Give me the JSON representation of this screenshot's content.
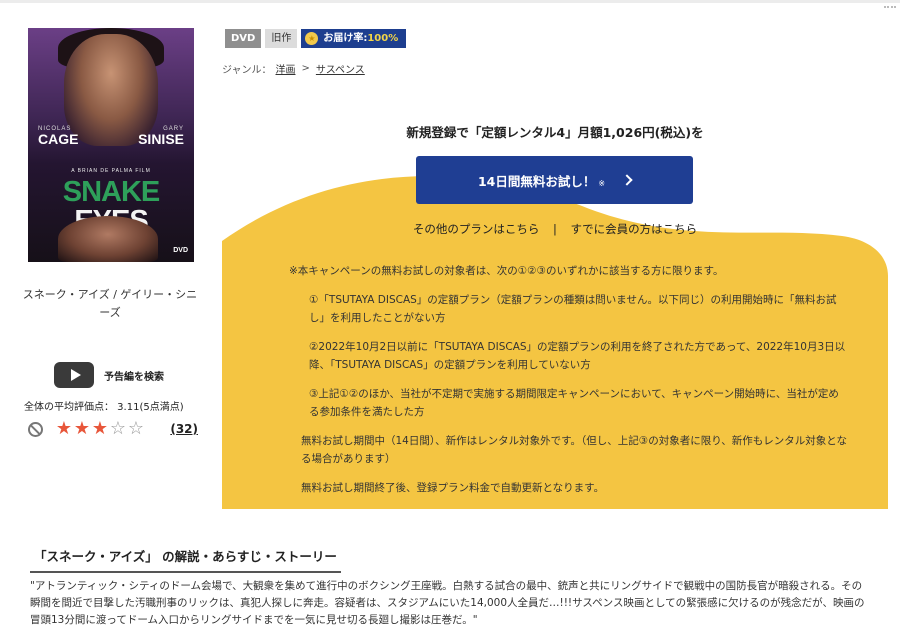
{
  "badges": {
    "format": "DVD",
    "catalog": "旧作",
    "delivery_label": "お届け率:",
    "delivery_rate": "100%"
  },
  "genre": {
    "label": "ジャンル：",
    "crumbs": [
      "洋画",
      "サスペンス"
    ],
    "separator": ">"
  },
  "poster": {
    "actor1_first": "NICOLAS",
    "actor1_last": "CAGE",
    "actor2_first": "GARY",
    "actor2_last": "SINISE",
    "director": "A BRIAN DE PALMA FILM",
    "title_part1": "SNAKE",
    "title_part2": "EYES",
    "format_mark": "DVD"
  },
  "item": {
    "name": "スネーク・アイズ / ゲイリー・シニーズ"
  },
  "trailer": {
    "label": "予告編を検索"
  },
  "rating": {
    "text": "全体の平均評価点： 3.11(5点満点)",
    "value": 3.11,
    "max": 5,
    "stars": [
      "★",
      "★",
      "★",
      "☆",
      "☆"
    ],
    "review_count": "(32)"
  },
  "campaign": {
    "headline": "新規登録で「定額レンタル4」月額1,026円(税込)を",
    "button_label": "14日間無料お試し！",
    "button_note": "※",
    "other_plans": "その他のプランはこちら",
    "divider": "|",
    "members": "すでに会員の方はこちら",
    "accent_color": "#f4c542",
    "button_color": "#1f3e93"
  },
  "terms": {
    "lead": "※本キャンペーンの無料お試しの対象者は、次の①②③のいずれかに該当する方に限ります。",
    "item1": "①「TSUTAYA DISCAS」の定額プラン（定額プランの種類は問いません。以下同じ）の利用開始時に「無料お試し」を利用したことがない方",
    "item2": "②2022年10月2日以前に「TSUTAYA DISCAS」の定額プランの利用を終了された方であって、2022年10月3日以降、「TSUTAYA DISCAS」の定額プランを利用していない方",
    "item3": "③上記①②のほか、当社が不定期で実施する期間限定キャンペーンにおいて、キャンペーン開始時に、当社が定める参加条件を満たした方",
    "note1": "無料お試し期間中（14日間）、新作はレンタル対象外です。（但し、上記③の対象者に限り、新作もレンタル対象となる場合があります）",
    "note2": "無料お試し期間終了後、登録プラン料金で自動更新となります。"
  },
  "synopsis": {
    "title": "「スネーク・アイズ」 の解説・あらすじ・ストーリー",
    "body": "\"アトランティック・シティのドーム会場で、大観衆を集めて進行中のボクシング王座戦。白熱する試合の最中、銃声と共にリングサイドで観戦中の国防長官が暗殺される。その瞬間を間近で目撃した汚職刑事のリックは、真犯人探しに奔走。容疑者は、スタジアムにいた14,000人全員だ…!!!サスペンス映画としての緊張感に欠けるのが残念だが、映画の冒頭13分間に渡ってドーム入口からリングサイドまでを一気に見せ切る長廻し撮影は圧巻だ。\""
  }
}
